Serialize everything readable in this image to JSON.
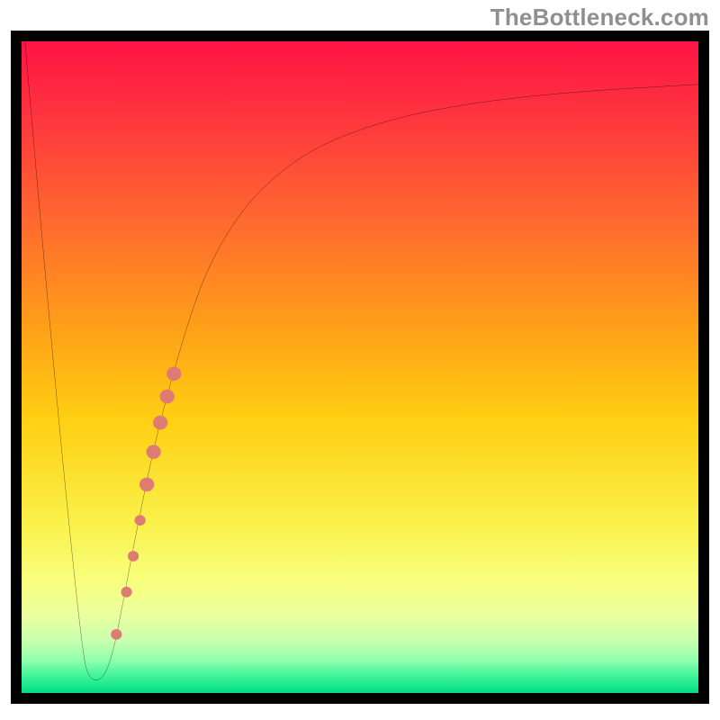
{
  "watermark": {
    "text": "TheBottleneck.com"
  },
  "chart_data": {
    "type": "line",
    "title": "",
    "xlabel": "",
    "ylabel": "",
    "xlim": [
      0,
      100
    ],
    "ylim": [
      0,
      100
    ],
    "grid": false,
    "legend": false,
    "background_gradient": {
      "direction": "vertical",
      "stops": [
        {
          "pos": 0.0,
          "color": "#ff1444"
        },
        {
          "pos": 0.1,
          "color": "#ff3040"
        },
        {
          "pos": 0.28,
          "color": "#ff6a2e"
        },
        {
          "pos": 0.44,
          "color": "#ffa018"
        },
        {
          "pos": 0.58,
          "color": "#ffcf12"
        },
        {
          "pos": 0.74,
          "color": "#faf14a"
        },
        {
          "pos": 0.83,
          "color": "#f8ff7e"
        },
        {
          "pos": 0.88,
          "color": "#ebff9e"
        },
        {
          "pos": 0.92,
          "color": "#c8ffae"
        },
        {
          "pos": 0.95,
          "color": "#8fffad"
        },
        {
          "pos": 0.97,
          "color": "#4cf59c"
        },
        {
          "pos": 0.99,
          "color": "#16e88d"
        },
        {
          "pos": 1.0,
          "color": "#05da83"
        }
      ]
    },
    "series": [
      {
        "name": "bottleneck-curve",
        "color": "#000000",
        "stroke_width": 2,
        "x": [
          0.5,
          3,
          6,
          9,
          10,
          12,
          13.5,
          15,
          17,
          20,
          24,
          27,
          30,
          34,
          40,
          46,
          55,
          65,
          75,
          85,
          95,
          100
        ],
        "y": [
          100,
          70,
          36,
          6,
          2,
          2,
          6,
          14,
          25,
          40,
          55,
          64,
          70,
          76,
          81.5,
          85,
          88.2,
          90.3,
          91.6,
          92.5,
          93.1,
          93.4
        ]
      }
    ],
    "highlight_points": {
      "name": "salmon-dots",
      "color": "#de7c73",
      "radius_large": 8,
      "radius_small": 6,
      "points": [
        {
          "x": 14.0,
          "y": 9.0,
          "r": 6
        },
        {
          "x": 15.5,
          "y": 15.5,
          "r": 6
        },
        {
          "x": 16.5,
          "y": 21.0,
          "r": 6
        },
        {
          "x": 17.5,
          "y": 26.5,
          "r": 6
        },
        {
          "x": 18.5,
          "y": 32.0,
          "r": 8
        },
        {
          "x": 19.5,
          "y": 37.0,
          "r": 8
        },
        {
          "x": 20.5,
          "y": 41.5,
          "r": 8
        },
        {
          "x": 21.5,
          "y": 45.5,
          "r": 8
        },
        {
          "x": 22.5,
          "y": 49.0,
          "r": 8
        }
      ]
    }
  }
}
